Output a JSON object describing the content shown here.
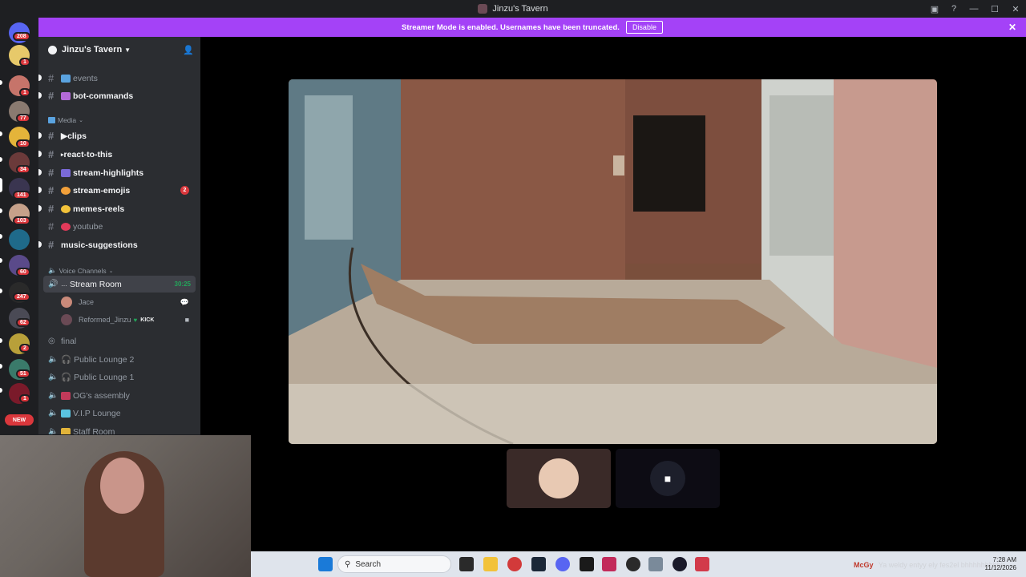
{
  "window": {
    "title": "Jinzu's Tavern",
    "buttons": [
      "inbox-icon",
      "help-icon",
      "minimize-icon",
      "maximize-icon",
      "close-icon"
    ]
  },
  "banner": {
    "text": "Streamer Mode is enabled. Usernames have been truncated.",
    "disable_label": "Disable",
    "color": "#a442f7"
  },
  "rail": {
    "servers": [
      {
        "name": "discord-home",
        "badge": "208",
        "color": "#5865f2"
      },
      {
        "name": "server-1",
        "badge": "1",
        "color": "#e7c96a"
      },
      {
        "name": "server-2",
        "badge": "1",
        "color": "#c6746a"
      },
      {
        "name": "server-3",
        "badge": "77",
        "color": "#8a7a70"
      },
      {
        "name": "server-4",
        "badge": "10",
        "color": "#e4b43a"
      },
      {
        "name": "server-5",
        "badge": "34",
        "color": "#6b3a3a"
      },
      {
        "name": "server-6",
        "badge": "141",
        "color": "#3a3550"
      },
      {
        "name": "server-7",
        "badge": "103",
        "color": "#c6a18a"
      },
      {
        "name": "server-8",
        "badge": "",
        "color": "#1f6a8a"
      },
      {
        "name": "server-9",
        "badge": "60",
        "color": "#5a4a8a"
      },
      {
        "name": "server-10",
        "badge": "247",
        "color": "#2a2a2a"
      },
      {
        "name": "server-11",
        "badge": "62",
        "color": "#4a4a55"
      },
      {
        "name": "server-12",
        "badge": "2",
        "color": "#b8a03a"
      },
      {
        "name": "server-13",
        "badge": "51",
        "color": "#3a7a6a"
      },
      {
        "name": "server-14",
        "badge": "1",
        "color": "#7a1a2a"
      }
    ],
    "new_label": "NEW"
  },
  "sidebar": {
    "server_name": "Jinzu's Tavern",
    "channels_top": [
      {
        "name": "events",
        "style": "muted",
        "emoji_color": "#5aa3e0"
      },
      {
        "name": "bot-commands",
        "style": "bold",
        "emoji_color": "#b36ad8"
      }
    ],
    "media_category": "Media",
    "media_channels": [
      {
        "name": "clips",
        "style": "bold",
        "prefix": "▶",
        "emoji_color": ""
      },
      {
        "name": "react-to-this",
        "style": "bold",
        "prefix": "▸",
        "emoji_color": ""
      },
      {
        "name": "stream-highlights",
        "style": "bold",
        "prefix": "",
        "emoji_color": "#7a6ad8"
      },
      {
        "name": "stream-emojis",
        "style": "bold",
        "prefix": "",
        "emoji_color": "#f2a03a",
        "badge": "2"
      },
      {
        "name": "memes-reels",
        "style": "bold",
        "prefix": "",
        "emoji_color": "#f2c23a"
      },
      {
        "name": "youtube",
        "style": "muted",
        "prefix": "",
        "emoji_color": "#e23a5a"
      },
      {
        "name": "music-suggestions",
        "style": "bold",
        "prefix": "",
        "emoji_color": ""
      }
    ],
    "voice_category": "Voice Channels",
    "stream_room": {
      "name": "Stream Room",
      "timer": "30:25"
    },
    "voice_users": [
      {
        "name": "Jace",
        "avatar_color": "#c98a7a"
      },
      {
        "name": "Reformed_Jinzu",
        "avatar_color": "#6a4a55",
        "tag": "KICK"
      }
    ],
    "voice_channels": [
      {
        "name": "final",
        "icon": "stage-icon"
      },
      {
        "name": "Public Lounge 2",
        "emoji": "🎧"
      },
      {
        "name": "Public Lounge 1",
        "emoji": "🎧"
      },
      {
        "name": "OG's assembly",
        "emoji_color": "#c23a5a"
      },
      {
        "name": "V.I.P Lounge",
        "emoji_color": "#5ac3e0"
      },
      {
        "name": "Staff Room",
        "emoji_color": "#e2b43a"
      }
    ]
  },
  "taskbar": {
    "search_placeholder": "Search",
    "tray_user": "McGy",
    "tray_message": "Ya weldy entyy ely fes2el bhhhhhhhhhh",
    "clock_time": "7:28 AM",
    "clock_date": "11/12/2026"
  }
}
